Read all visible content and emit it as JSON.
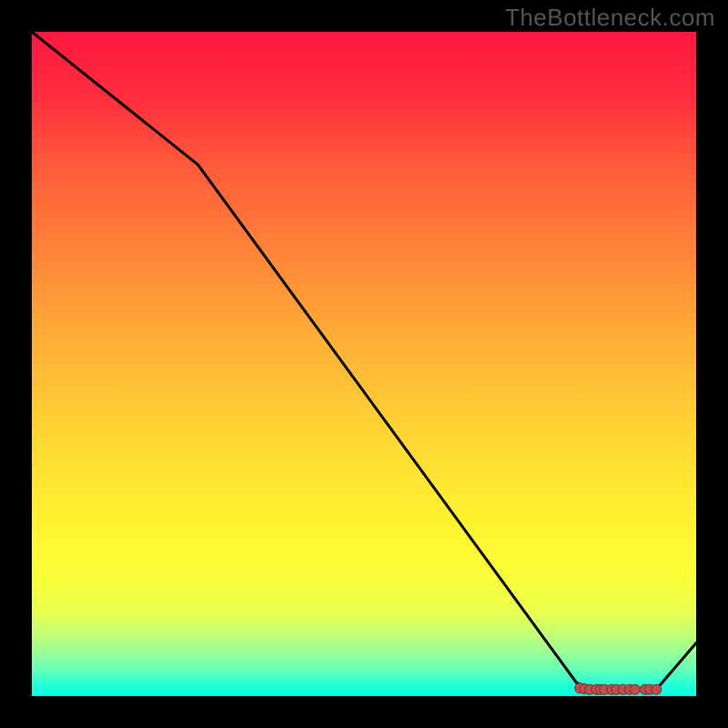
{
  "attribution": "TheBottleneck.com",
  "chart_data": {
    "type": "line",
    "title": "",
    "xlabel": "",
    "ylabel": "",
    "xlim": [
      0,
      100
    ],
    "ylim": [
      0,
      100
    ],
    "x": [
      0,
      25,
      82,
      85,
      94,
      100
    ],
    "values": [
      100,
      80,
      2,
      1,
      1,
      8
    ],
    "markers_x": [
      82.5,
      83.2,
      84.0,
      85.0,
      85.6,
      86.2,
      87.3,
      88.0,
      89.0,
      90.0,
      90.8,
      92.3,
      93.0,
      94.0
    ],
    "markers_y": [
      1.2,
      1.1,
      1.0,
      1.0,
      1.0,
      1.0,
      1.0,
      1.0,
      1.0,
      1.0,
      1.0,
      1.0,
      1.0,
      1.0
    ],
    "stroke": "#000000",
    "marker_fill": "#c05050",
    "marker_stroke": "#803030"
  }
}
